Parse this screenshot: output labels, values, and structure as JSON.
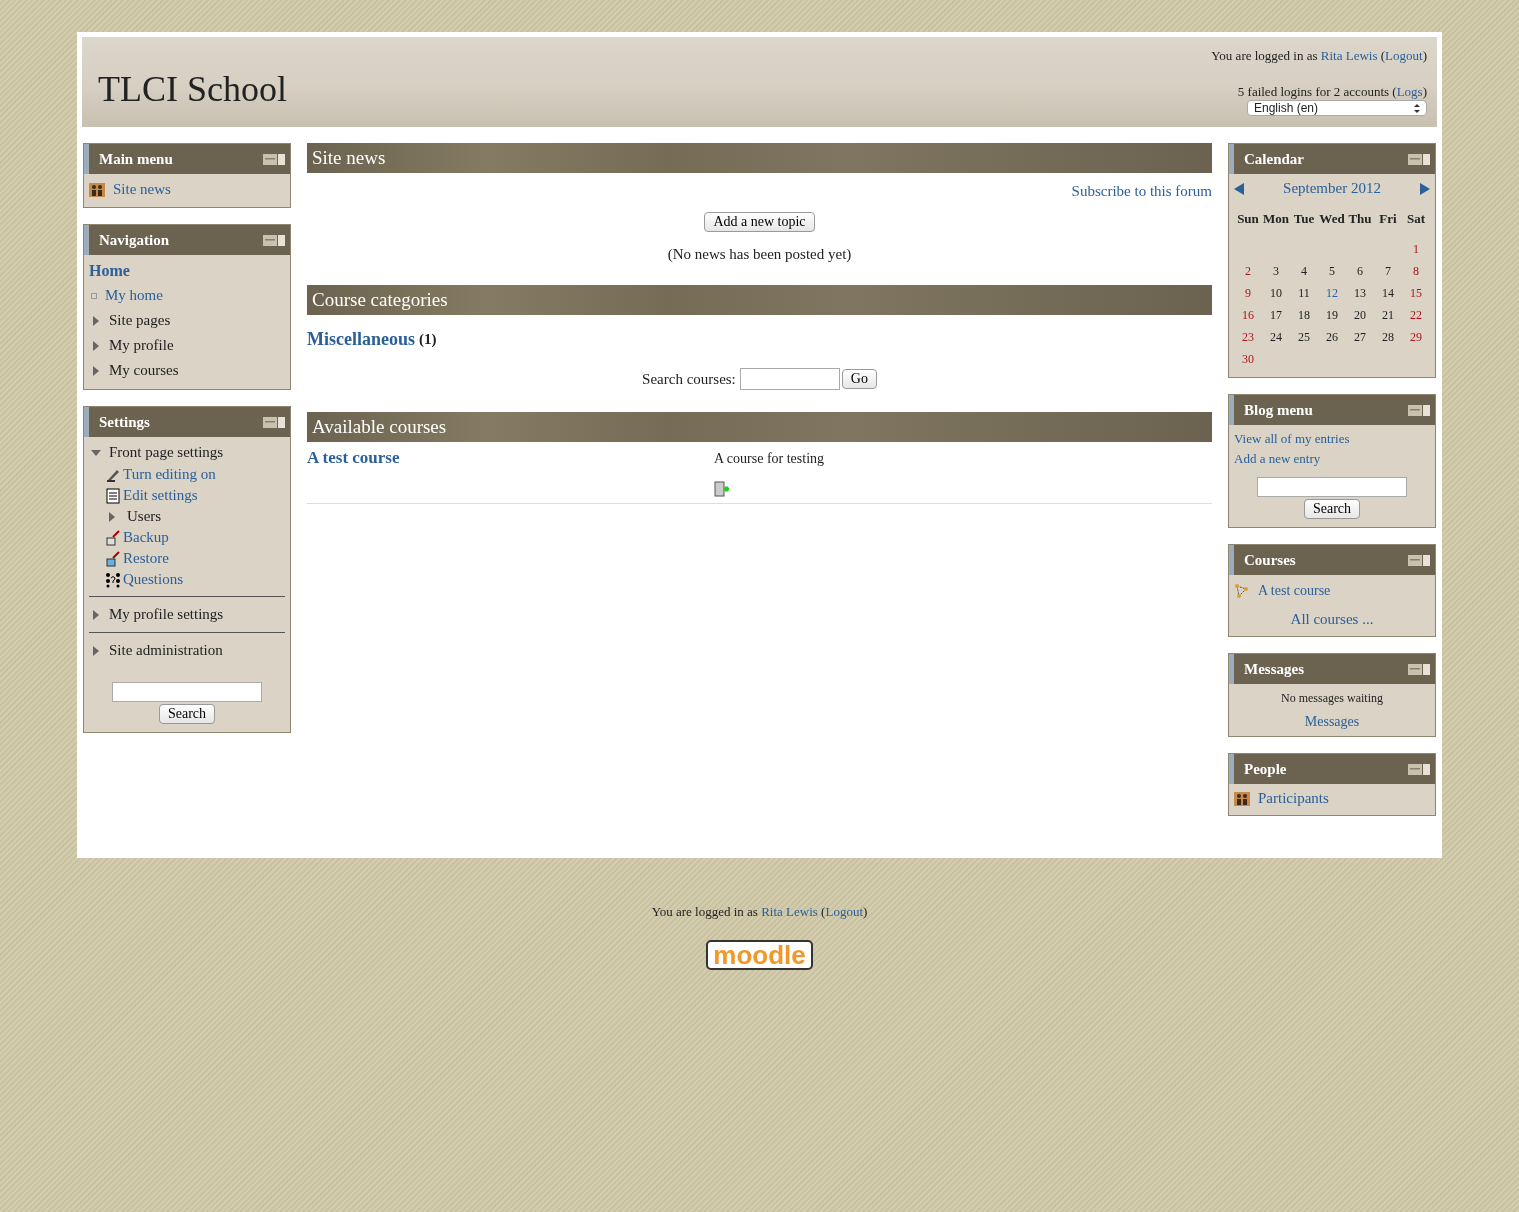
{
  "header": {
    "site_name": "TLCI School",
    "login": {
      "prefix": "You are logged in as",
      "user": "Rita Lewis",
      "open": "(",
      "logout": "Logout",
      "close": ")"
    },
    "failed": {
      "text": "5 failed logins for 2 accounts",
      "open": "(",
      "link": "Logs",
      "close": ")"
    },
    "language": "English (en)"
  },
  "main_menu": {
    "title": "Main menu",
    "items": [
      "Site news"
    ]
  },
  "navigation": {
    "title": "Navigation",
    "home": "Home",
    "items": [
      {
        "label": "My home",
        "kind": "link"
      },
      {
        "label": "Site pages",
        "kind": "branch",
        "expanded": false
      },
      {
        "label": "My profile",
        "kind": "branch",
        "expanded": false
      },
      {
        "label": "My courses",
        "kind": "branch",
        "expanded": false
      }
    ]
  },
  "settings": {
    "title": "Settings",
    "groups": [
      {
        "label": "Front page settings",
        "expanded": true,
        "children": [
          {
            "label": "Turn editing on",
            "kind": "link"
          },
          {
            "label": "Edit settings",
            "kind": "link"
          },
          {
            "label": "Users",
            "kind": "branch",
            "expanded": false
          },
          {
            "label": "Backup",
            "kind": "link"
          },
          {
            "label": "Restore",
            "kind": "link"
          },
          {
            "label": "Questions",
            "kind": "link"
          }
        ]
      },
      {
        "label": "My profile settings",
        "expanded": false
      },
      {
        "label": "Site administration",
        "expanded": false
      }
    ],
    "search_button": "Search"
  },
  "site_news": {
    "title": "Site news",
    "subscribe": "Subscribe to this forum",
    "add_button": "Add a new topic",
    "empty": "(No news has been posted yet)"
  },
  "course_categories": {
    "title": "Course categories",
    "categories": [
      {
        "name": "Miscellaneous",
        "count": "(1)"
      }
    ],
    "search_label": "Search courses:",
    "go_button": "Go"
  },
  "available_courses": {
    "title": "Available courses",
    "courses": [
      {
        "name": "A test course",
        "summary": "A course for testing"
      }
    ]
  },
  "calendar": {
    "title": "Calendar",
    "month": "September 2012",
    "weekdays": [
      "Sun",
      "Mon",
      "Tue",
      "Wed",
      "Thu",
      "Fri",
      "Sat"
    ],
    "weeks": [
      [
        {
          "kind": "blank"
        },
        {
          "kind": "blank"
        },
        {
          "kind": "blank"
        },
        {
          "kind": "blank"
        },
        {
          "kind": "blank"
        },
        {
          "kind": "blank"
        },
        {
          "day": "1",
          "kind": "weekend"
        }
      ],
      [
        {
          "day": "2",
          "kind": "weekend"
        },
        {
          "day": "3",
          "kind": "weekday"
        },
        {
          "day": "4",
          "kind": "weekday"
        },
        {
          "day": "5",
          "kind": "weekday"
        },
        {
          "day": "6",
          "kind": "weekday"
        },
        {
          "day": "7",
          "kind": "weekday"
        },
        {
          "day": "8",
          "kind": "weekend"
        }
      ],
      [
        {
          "day": "9",
          "kind": "weekend"
        },
        {
          "day": "10",
          "kind": "weekday"
        },
        {
          "day": "11",
          "kind": "weekday"
        },
        {
          "day": "12",
          "kind": "today"
        },
        {
          "day": "13",
          "kind": "weekday"
        },
        {
          "day": "14",
          "kind": "weekday"
        },
        {
          "day": "15",
          "kind": "weekend"
        }
      ],
      [
        {
          "day": "16",
          "kind": "weekend"
        },
        {
          "day": "17",
          "kind": "weekday"
        },
        {
          "day": "18",
          "kind": "weekday"
        },
        {
          "day": "19",
          "kind": "weekday"
        },
        {
          "day": "20",
          "kind": "weekday"
        },
        {
          "day": "21",
          "kind": "weekday"
        },
        {
          "day": "22",
          "kind": "weekend"
        }
      ],
      [
        {
          "day": "23",
          "kind": "weekend"
        },
        {
          "day": "24",
          "kind": "weekday"
        },
        {
          "day": "25",
          "kind": "weekday"
        },
        {
          "day": "26",
          "kind": "weekday"
        },
        {
          "day": "27",
          "kind": "weekday"
        },
        {
          "day": "28",
          "kind": "weekday"
        },
        {
          "day": "29",
          "kind": "weekend"
        }
      ],
      [
        {
          "day": "30",
          "kind": "weekend"
        },
        {
          "kind": "blank"
        },
        {
          "kind": "blank"
        },
        {
          "kind": "blank"
        },
        {
          "kind": "blank"
        },
        {
          "kind": "blank"
        },
        {
          "kind": "blank"
        }
      ]
    ]
  },
  "blog_menu": {
    "title": "Blog menu",
    "links": [
      "View all of my entries",
      "Add a new entry"
    ],
    "search_button": "Search"
  },
  "courses_block": {
    "title": "Courses",
    "courses": [
      "A test course"
    ],
    "all_link": "All courses ..."
  },
  "messages": {
    "title": "Messages",
    "status": "No messages waiting",
    "link": "Messages"
  },
  "people": {
    "title": "People",
    "link": "Participants"
  },
  "footer": {
    "login": {
      "prefix": "You are logged in as",
      "user": "Rita Lewis",
      "open": "(",
      "logout": "Logout",
      "close": ")"
    },
    "logo": "moodle"
  }
}
